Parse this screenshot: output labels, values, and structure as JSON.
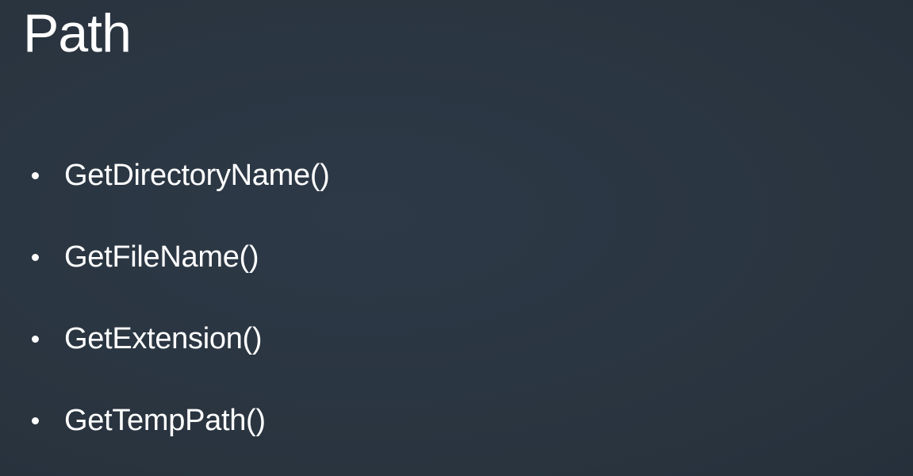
{
  "slide": {
    "title": "Path",
    "bullets": [
      {
        "text": "GetDirectoryName()"
      },
      {
        "text": "GetFileName()"
      },
      {
        "text": "GetExtension()"
      },
      {
        "text": "GetTempPath()"
      }
    ]
  },
  "colors": {
    "background": "#2a3543",
    "text": "#ffffff"
  }
}
